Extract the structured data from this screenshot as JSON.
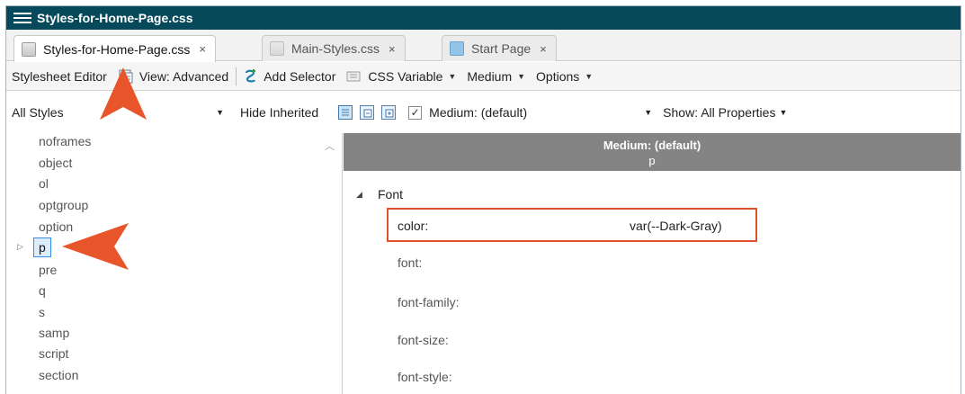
{
  "window": {
    "title": "Styles-for-Home-Page.css"
  },
  "tabs": [
    {
      "label": "Styles-for-Home-Page.css",
      "close": "×",
      "icon": "css-file-icon",
      "active": true
    },
    {
      "label": "Main-Styles.css",
      "close": "×",
      "icon": "css-file-icon",
      "active": false
    },
    {
      "label": "Start Page",
      "close": "×",
      "icon": "start-page-icon",
      "active": false
    }
  ],
  "toolbar": {
    "stylesheet_editor": "Stylesheet Editor",
    "view": "View: Advanced",
    "add_selector": "Add Selector",
    "css_variable": "CSS Variable",
    "medium": "Medium",
    "options": "Options"
  },
  "filter_bar": {
    "styles_select": "All Styles",
    "hide_inherited": "Hide Inherited",
    "medium_select": "Medium: (default)",
    "medium_checked": true,
    "show_select": "Show: All Properties"
  },
  "selectors": [
    "noframes",
    "object",
    "ol",
    "optgroup",
    "option",
    "p",
    "pre",
    "q",
    "s",
    "samp",
    "script",
    "section"
  ],
  "selected_selector": "p",
  "properties_panel": {
    "medium_header": "Medium: (default)",
    "selector_header": "p",
    "group": "Font",
    "properties": [
      {
        "name": "color:",
        "value": "var(--Dark-Gray)"
      },
      {
        "name": "font:",
        "value": ""
      },
      {
        "name": "font-family:",
        "value": ""
      },
      {
        "name": "font-size:",
        "value": ""
      },
      {
        "name": "font-style:",
        "value": ""
      }
    ]
  },
  "colors": {
    "titlebar": "#06495b",
    "callout": "#e8552a",
    "highlight_border": "#e0522a",
    "selection": "#dcecfb",
    "panel_header": "#848484"
  }
}
